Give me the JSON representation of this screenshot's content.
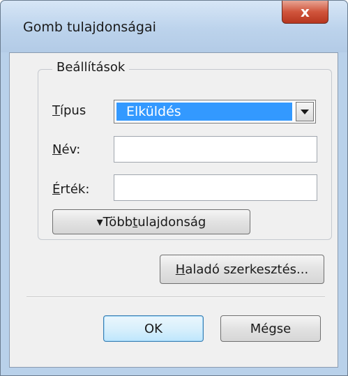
{
  "window": {
    "title": "Gomb tulajdonságai",
    "close_label": "x"
  },
  "group": {
    "legend": "Beállítások"
  },
  "type_field": {
    "label_first": "T",
    "label_rest": "ípus",
    "value": "Elküldés"
  },
  "name_field": {
    "label_first": "N",
    "label_rest": "év:",
    "value": ""
  },
  "value_field": {
    "label_first": "É",
    "label_mid": "r",
    "label_rest": "ték:",
    "value": ""
  },
  "more_button": {
    "prefix": "▾Több ",
    "underlined": "t",
    "rest": "ulajdonság"
  },
  "advanced_button": {
    "underlined": "H",
    "rest": "aladó szerkesztés..."
  },
  "ok_button": {
    "label": "OK"
  },
  "cancel_button": {
    "label": "Mégse"
  },
  "colors": {
    "frame": "#b9d1ea",
    "selection": "#3399ff",
    "close": "#d0553c"
  }
}
